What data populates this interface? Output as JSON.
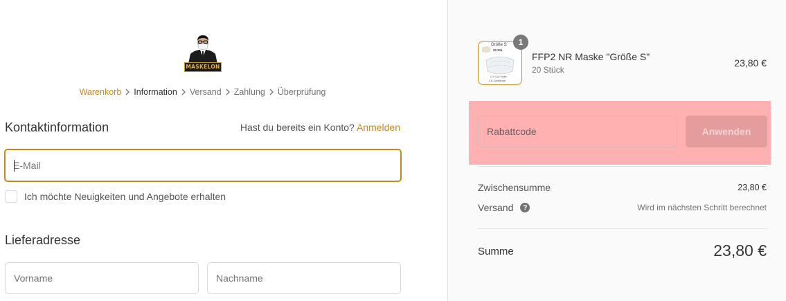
{
  "logo": {
    "text": "MASKELON",
    "icon": "man-in-suit-with-mask-logo"
  },
  "breadcrumb": {
    "items": [
      {
        "label": "Warenkorb",
        "state": "link"
      },
      {
        "label": "Information",
        "state": "active"
      },
      {
        "label": "Versand",
        "state": "inactive"
      },
      {
        "label": "Zahlung",
        "state": "inactive"
      },
      {
        "label": "Überprüfung",
        "state": "inactive"
      }
    ]
  },
  "contact": {
    "title": "Kontaktinformation",
    "login_prompt": "Hast du bereits ein Konto?",
    "login_link": "Anmelden",
    "email_placeholder": "E-Mail",
    "newsletter_label": "Ich möchte Neuigkeiten und Angebote erhalten"
  },
  "shipping": {
    "title": "Lieferadresse",
    "firstname_placeholder": "Vorname",
    "lastname_placeholder": "Nachname"
  },
  "cart": {
    "item": {
      "name": "FFP2 NR Maske \"Größe S\"",
      "variant": "20 Stück",
      "price": "23,80 €",
      "quantity": "1",
      "thumb": {
        "line1": "Größe S",
        "line2": "20 Stk.",
        "line3": "LD-Cyo Halle",
        "line4": "CE-Zertifiziert"
      }
    },
    "discount": {
      "placeholder": "Rabattcode",
      "button_label": "Anwenden"
    },
    "subtotal_label": "Zwischensumme",
    "subtotal_value": "23,80 €",
    "shipping_label": "Versand",
    "shipping_value": "Wird im nächsten Schritt berechnet",
    "total_label": "Summe",
    "total_value": "23,80 €"
  },
  "colors": {
    "accent": "#c8871d",
    "highlight": "#ffb0b0",
    "button_disabled": "#e49c9c",
    "sidebar_bg": "#fafafa"
  }
}
